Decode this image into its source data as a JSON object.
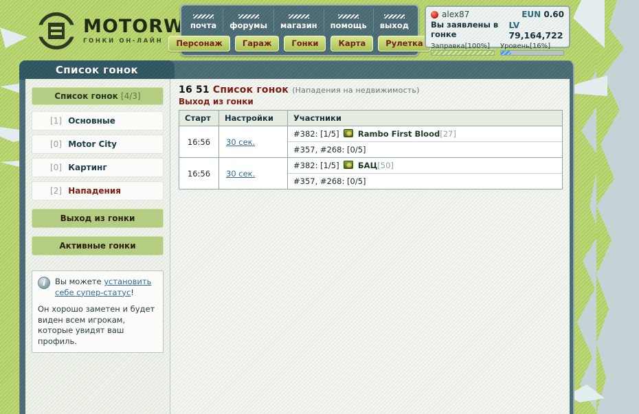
{
  "brand": {
    "name": "MOTORWARS.RU",
    "tagline": "ГОНКИ ОН-ЛАЙН"
  },
  "nav": {
    "top": [
      {
        "label": "почта"
      },
      {
        "label": "форумы"
      },
      {
        "label": "магазин"
      },
      {
        "label": "помощь"
      },
      {
        "label": "выход"
      }
    ],
    "bottom": [
      {
        "label": "Персонаж"
      },
      {
        "label": "Гараж"
      },
      {
        "label": "Гонки"
      },
      {
        "label": "Карта"
      },
      {
        "label": "Рулетка"
      }
    ]
  },
  "status": {
    "nickname": "alex87",
    "state": "Вы заявлены в гонке",
    "eun_label": "EUN",
    "eun_value": "0.60",
    "lv_label": "LV",
    "lv_value": "79,164,722",
    "fuel_label": "Заправка[100%]",
    "fuel_percent": 100,
    "level_label": "Уровень[16%]",
    "level_percent": 16
  },
  "sidebar": {
    "tab_title": "Список гонок",
    "section_title": "Список гонок",
    "section_count": "[4/3]",
    "items": [
      {
        "count": "[1]",
        "label": "Основные"
      },
      {
        "count": "[0]",
        "label": "Motor City"
      },
      {
        "count": "[0]",
        "label": "Картинг"
      },
      {
        "count": "[2]",
        "label": "Нападения"
      }
    ],
    "buttons": [
      {
        "label": "Выход из гонки"
      },
      {
        "label": "Активные гонки"
      }
    ],
    "info": {
      "lead": "Вы можете ",
      "link": "установить себе супер-статус",
      "lead_end": "!",
      "body": "Он хорошо заметен и будет виден всем игрокам, которые увидят ваш профиль."
    }
  },
  "main": {
    "clock": "16 51",
    "title": "Список гонок",
    "subtitle": "(Нападения на недвижимость)",
    "exit_link": "Выход из гонки",
    "table": {
      "columns": [
        "Старт",
        "Настройки",
        "Участники"
      ],
      "rows": [
        {
          "start": "16:56",
          "setup": "30 сек.",
          "line1_prefix": "#382: [1/5]",
          "line1_name": "Rambo First Blood",
          "line1_level": "[27]",
          "line2": "#357, #268: [0/5]"
        },
        {
          "start": "16:56",
          "setup": "30 сек.",
          "line1_prefix": "#382: [1/5]",
          "line1_name": "БАЦ",
          "line1_level": "[50]",
          "line2": "#357, #268: [0/5]"
        }
      ]
    }
  },
  "colors": {
    "green": "#b2cf63",
    "teal": "#4a6a73",
    "dark_teal": "#2f5560",
    "accent_red": "#7d1d12",
    "link_blue": "#2d6a9a"
  }
}
